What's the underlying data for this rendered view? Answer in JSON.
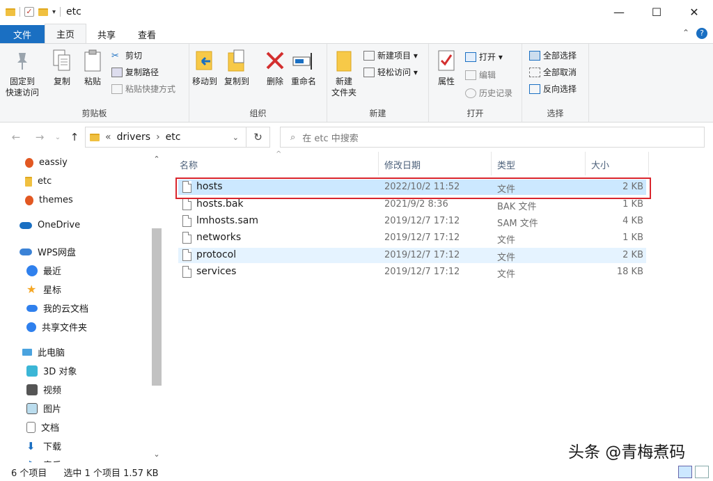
{
  "window": {
    "title": "etc",
    "minimize": "—",
    "maximize": "☐",
    "close": "✕"
  },
  "tabs": [
    {
      "label": "文件"
    },
    {
      "label": "主页"
    },
    {
      "label": "共享"
    },
    {
      "label": "查看"
    }
  ],
  "ribbon": {
    "clipboard": {
      "label": "剪贴板",
      "pin": "固定到\n快速访问",
      "pin1": "固定到",
      "pin2": "快速访问",
      "copy": "复制",
      "paste": "粘贴",
      "cut": "剪切",
      "copy_path": "复制路径",
      "paste_shortcut": "粘贴快捷方式"
    },
    "organize": {
      "label": "组织",
      "move_to": "移动到",
      "copy_to": "复制到",
      "delete": "删除",
      "rename": "重命名"
    },
    "new": {
      "label": "新建",
      "new_folder1": "新建",
      "new_folder2": "文件夹",
      "new_item": "新建项目 ▾",
      "easy_access": "轻松访问 ▾"
    },
    "open": {
      "label": "打开",
      "properties": "属性",
      "open": "打开 ▾",
      "edit": "编辑",
      "history": "历史记录"
    },
    "select": {
      "label": "选择",
      "select_all": "全部选择",
      "select_none": "全部取消",
      "invert": "反向选择"
    }
  },
  "address": {
    "overflow": "«",
    "crumbs": [
      "drivers",
      "etc"
    ],
    "sep": "›",
    "search_placeholder": "在 etc 中搜索"
  },
  "nav": [
    {
      "label": "eassiy"
    },
    {
      "label": "etc"
    },
    {
      "label": "themes"
    },
    {
      "label": "OneDrive"
    },
    {
      "label": "WPS网盘"
    },
    {
      "label": "最近"
    },
    {
      "label": "星标"
    },
    {
      "label": "我的云文档"
    },
    {
      "label": "共享文件夹"
    },
    {
      "label": "此电脑"
    },
    {
      "label": "3D 对象"
    },
    {
      "label": "视频"
    },
    {
      "label": "图片"
    },
    {
      "label": "文档"
    },
    {
      "label": "下载"
    },
    {
      "label": "音乐"
    }
  ],
  "columns": {
    "name": "名称",
    "date": "修改日期",
    "type": "类型",
    "size": "大小"
  },
  "files": [
    {
      "name": "hosts",
      "date": "2022/10/2 11:52",
      "type": "文件",
      "size": "2 KB"
    },
    {
      "name": "hosts.bak",
      "date": "2021/9/2 8:36",
      "type": "BAK 文件",
      "size": "1 KB"
    },
    {
      "name": "lmhosts.sam",
      "date": "2019/12/7 17:12",
      "type": "SAM 文件",
      "size": "4 KB"
    },
    {
      "name": "networks",
      "date": "2019/12/7 17:12",
      "type": "文件",
      "size": "1 KB"
    },
    {
      "name": "protocol",
      "date": "2019/12/7 17:12",
      "type": "文件",
      "size": "2 KB"
    },
    {
      "name": "services",
      "date": "2019/12/7 17:12",
      "type": "文件",
      "size": "18 KB"
    }
  ],
  "status": {
    "count": "6 个项目",
    "selected": "选中 1 个项目  1.57 KB"
  },
  "watermark": "头条 @青梅煮码",
  "colors": {
    "accent": "#1a6fc2",
    "selection": "#cce8ff",
    "highlight_box": "#d9252d"
  }
}
